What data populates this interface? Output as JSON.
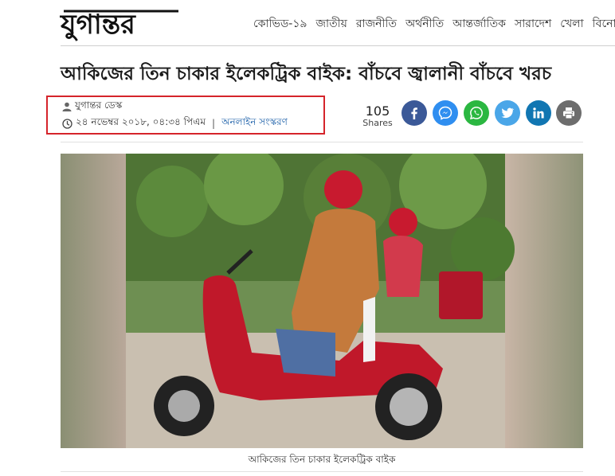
{
  "site": {
    "logo_text": "যুগান্তর"
  },
  "nav": [
    "কোভিড-১৯",
    "জাতীয়",
    "রাজনীতি",
    "অর্থনীতি",
    "আন্তর্জাতিক",
    "সারাদেশ",
    "খেলা",
    "বিনোদন"
  ],
  "article": {
    "headline": "আকিজের তিন চাকার ইলেকট্রিক বাইক: বাঁচবে জ্বালানী বাঁচবে খরচ",
    "author": "যুগান্তর ডেস্ক",
    "date": "২৪ নভেম্বর ২০১৮, ০৪:৩৪ পিএম",
    "separator": "|",
    "edition": "অনলাইন সংস্করণ",
    "caption": "আকিজের তিন চাকার ইলেকট্রিক বাইক"
  },
  "shares": {
    "count": "105",
    "label": "Shares",
    "buttons": [
      {
        "name": "facebook-share-button",
        "icon": "facebook-icon",
        "color": "#3b5998"
      },
      {
        "name": "messenger-share-button",
        "icon": "messenger-icon",
        "color": "#2f8ef0"
      },
      {
        "name": "whatsapp-share-button",
        "icon": "whatsapp-icon",
        "color": "#2bb741"
      },
      {
        "name": "twitter-share-button",
        "icon": "twitter-icon",
        "color": "#4aa6e8"
      },
      {
        "name": "linkedin-share-button",
        "icon": "linkedin-icon",
        "color": "#1176b2"
      },
      {
        "name": "print-button",
        "icon": "print-icon",
        "color": "#6d6d6d"
      }
    ]
  },
  "colors": {
    "highlight_box": "#d5242b",
    "link": "#1b5fa8"
  }
}
